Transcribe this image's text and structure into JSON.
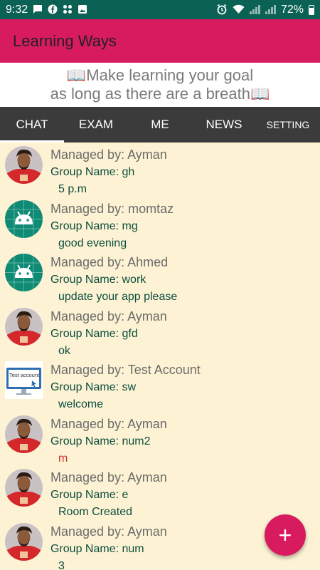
{
  "status_bar": {
    "time": "9:32",
    "battery": "72%"
  },
  "app_bar": {
    "title": "Learning Ways"
  },
  "banner": {
    "line1": "📖Make learning your goal",
    "line2": "as long as there are a breath📖"
  },
  "tabs": [
    {
      "label": "CHAT",
      "active": true
    },
    {
      "label": "EXAM"
    },
    {
      "label": "ME"
    },
    {
      "label": "NEWS"
    },
    {
      "label": "SETTING"
    }
  ],
  "chats": [
    {
      "manager": "Managed by: Ayman",
      "group": "Group Name: gh",
      "message": "5 p.m",
      "avatar": "player-photo"
    },
    {
      "manager": "Managed by: momtaz",
      "group": "Group Name: mg",
      "message": "good evening",
      "avatar": "android-icon"
    },
    {
      "manager": "Managed by: Ahmed",
      "group": "Group Name: work",
      "message": "update your app please",
      "avatar": "android-icon"
    },
    {
      "manager": "Managed by: Ayman",
      "group": "Group Name: gfd",
      "message": "ok",
      "avatar": "player-photo"
    },
    {
      "manager": "Managed by: Test Account",
      "group": "Group Name: sw",
      "message": "welcome",
      "avatar": "test-account",
      "avatar_text": "Test account"
    },
    {
      "manager": "Managed by: Ayman",
      "group": "Group Name: num2",
      "message": "m",
      "avatar": "player-photo",
      "message_color": "#d32f2f"
    },
    {
      "manager": "Managed by: Ayman",
      "group": "Group Name: e",
      "message": "Room Created",
      "avatar": "player-photo"
    },
    {
      "manager": "Managed by: Ayman",
      "group": "Group Name: num",
      "message": "3",
      "avatar": "player-photo"
    }
  ],
  "fab": {
    "icon": "plus-icon",
    "label": "+"
  },
  "colors": {
    "status_bar": "#0b6153",
    "app_bar": "#d81b5f",
    "tabs": "#3b3b3b",
    "list_bg": "#fdf3d4",
    "text_green": "#0b4d3e"
  }
}
